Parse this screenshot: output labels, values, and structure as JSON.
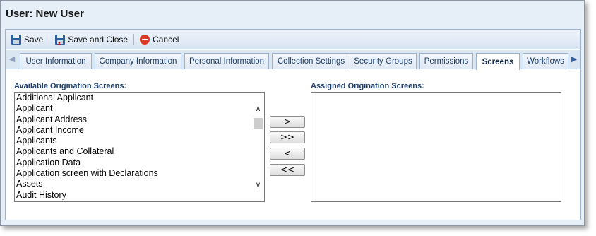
{
  "window": {
    "title": "User: New User"
  },
  "toolbar": {
    "save_label": "Save",
    "save_close_label": "Save and Close",
    "cancel_label": "Cancel"
  },
  "tabs": [
    {
      "label": "User Information"
    },
    {
      "label": "Company Information"
    },
    {
      "label": "Personal Information"
    },
    {
      "label": "Collection Settings"
    },
    {
      "label": "Security Groups"
    },
    {
      "label": "Permissions"
    },
    {
      "label": "Screens",
      "active": true
    },
    {
      "label": "Workflows"
    }
  ],
  "available": {
    "label": "Available Origination Screens:",
    "items": [
      "Additional Applicant",
      "Applicant",
      "Applicant Address",
      "Applicant Income",
      "Applicants",
      "Applicants and Collateral",
      "Application Data",
      "Application screen with Declarations",
      "Assets",
      "Audit History"
    ]
  },
  "assigned": {
    "label": "Assigned Origination Screens:",
    "items": []
  },
  "move_buttons": {
    "add_one": ">",
    "add_all": ">>",
    "remove_one": "<",
    "remove_all": "<<"
  },
  "icons": {
    "save": "floppy-disk-icon",
    "save_close": "floppy-disk-close-icon",
    "cancel": "cancel-circle-icon",
    "scroll_left": "arrow-left-icon",
    "scroll_right": "arrow-right-icon"
  }
}
